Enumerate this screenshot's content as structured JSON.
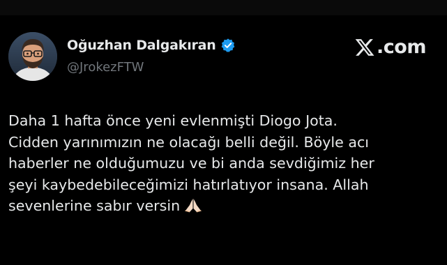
{
  "author": {
    "display_name": "Oğuzhan Dalgakıran",
    "handle": "@JrokezFTW",
    "verified": true,
    "avatar": "bearded-man-glasses-avatar"
  },
  "brand": {
    "logo": "x-logo-icon",
    "label": ".com"
  },
  "tweet": {
    "lines": [
      "Daha 1 hafta önce yeni evlenmişti Diogo Jota.",
      "Cidden yarınımızın ne olacağı belli değil. Böyle acı",
      "haberler ne olduğumuzu ve bi anda sevdiğimiz her",
      "şeyi kaybedebileceğimizi hatırlatıyor insana. Allah",
      "sevenlerine sabır versin"
    ],
    "emoji": "praying-hands-icon"
  },
  "colors": {
    "background": "#000000",
    "text": "#e7e9ea",
    "secondary_text": "#71767b",
    "verified_badge": "#1d9bf0"
  }
}
